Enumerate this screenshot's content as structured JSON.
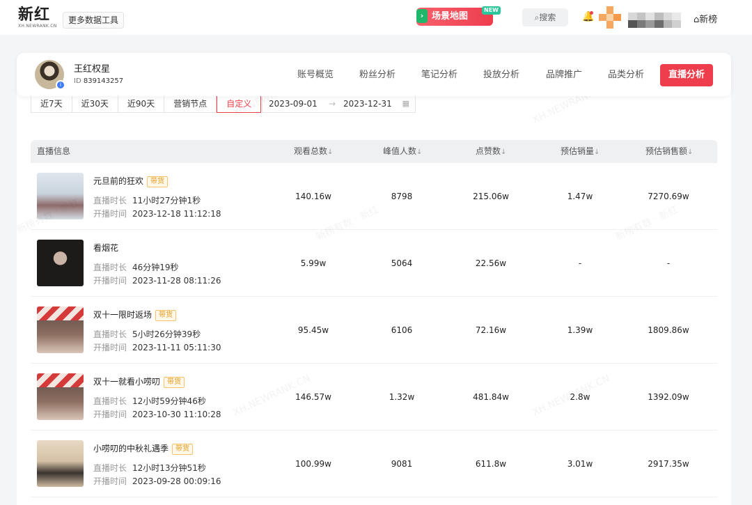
{
  "header": {
    "logo_main": "新红",
    "logo_sub": "XH.NEWRANK.CN",
    "more_tools": "更多数据工具",
    "scene_map": "场景地图",
    "scene_map_badge": "NEW",
    "search": "搜索",
    "brand_link": "新榜"
  },
  "profile": {
    "name": "王红权星",
    "id_label": "ID",
    "id_value": "839143257"
  },
  "nav": [
    {
      "label": "账号概览"
    },
    {
      "label": "粉丝分析"
    },
    {
      "label": "笔记分析"
    },
    {
      "label": "投放分析"
    },
    {
      "label": "品牌推广"
    },
    {
      "label": "品类分析"
    },
    {
      "label": "直播分析"
    }
  ],
  "filters": {
    "options": [
      "近7天",
      "近30天",
      "近90天",
      "营销节点",
      "自定义"
    ],
    "active": "自定义",
    "start_date": "2023-09-01",
    "end_date": "2023-12-31"
  },
  "table": {
    "columns": [
      "直播信息",
      "观看总数",
      "峰值人数",
      "点赞数",
      "预估销量",
      "预估销售额"
    ],
    "duration_label": "直播时长",
    "start_label": "开播时间",
    "tag_label": "带货",
    "rows": [
      {
        "title": "元旦前的狂欢",
        "tag": true,
        "duration": "11小时27分钟1秒",
        "start": "2023-12-18 11:12:18",
        "views": "140.16w",
        "peak": "8798",
        "likes": "215.06w",
        "sales": "1.47w",
        "revenue": "7270.69w"
      },
      {
        "title": "看烟花",
        "tag": false,
        "duration": "46分钟19秒",
        "start": "2023-11-28 08:11:26",
        "views": "5.99w",
        "peak": "5064",
        "likes": "22.56w",
        "sales": "-",
        "revenue": "-"
      },
      {
        "title": "双十一限时返场",
        "tag": true,
        "duration": "5小时26分钟39秒",
        "start": "2023-11-11 05:11:30",
        "views": "95.45w",
        "peak": "6106",
        "likes": "72.16w",
        "sales": "1.39w",
        "revenue": "1809.86w"
      },
      {
        "title": "双十一就看小唠叨",
        "tag": true,
        "duration": "12小时59分钟46秒",
        "start": "2023-10-30 11:10:28",
        "views": "146.57w",
        "peak": "1.32w",
        "likes": "481.84w",
        "sales": "2.8w",
        "revenue": "1392.09w"
      },
      {
        "title": "小唠叨的中秋礼遇季",
        "tag": true,
        "duration": "12小时13分钟51秒",
        "start": "2023-09-28 00:09:16",
        "views": "100.99w",
        "peak": "9081",
        "likes": "611.8w",
        "sales": "3.01w",
        "revenue": "2917.35w"
      }
    ]
  },
  "watermarks": [
    "XH.NEWRANK.CN",
    "新榜有数 · 新红"
  ],
  "colors": {
    "accent": "#ef3e4b",
    "tag_border": "#f5c46a",
    "tag_text": "#e49a20"
  }
}
